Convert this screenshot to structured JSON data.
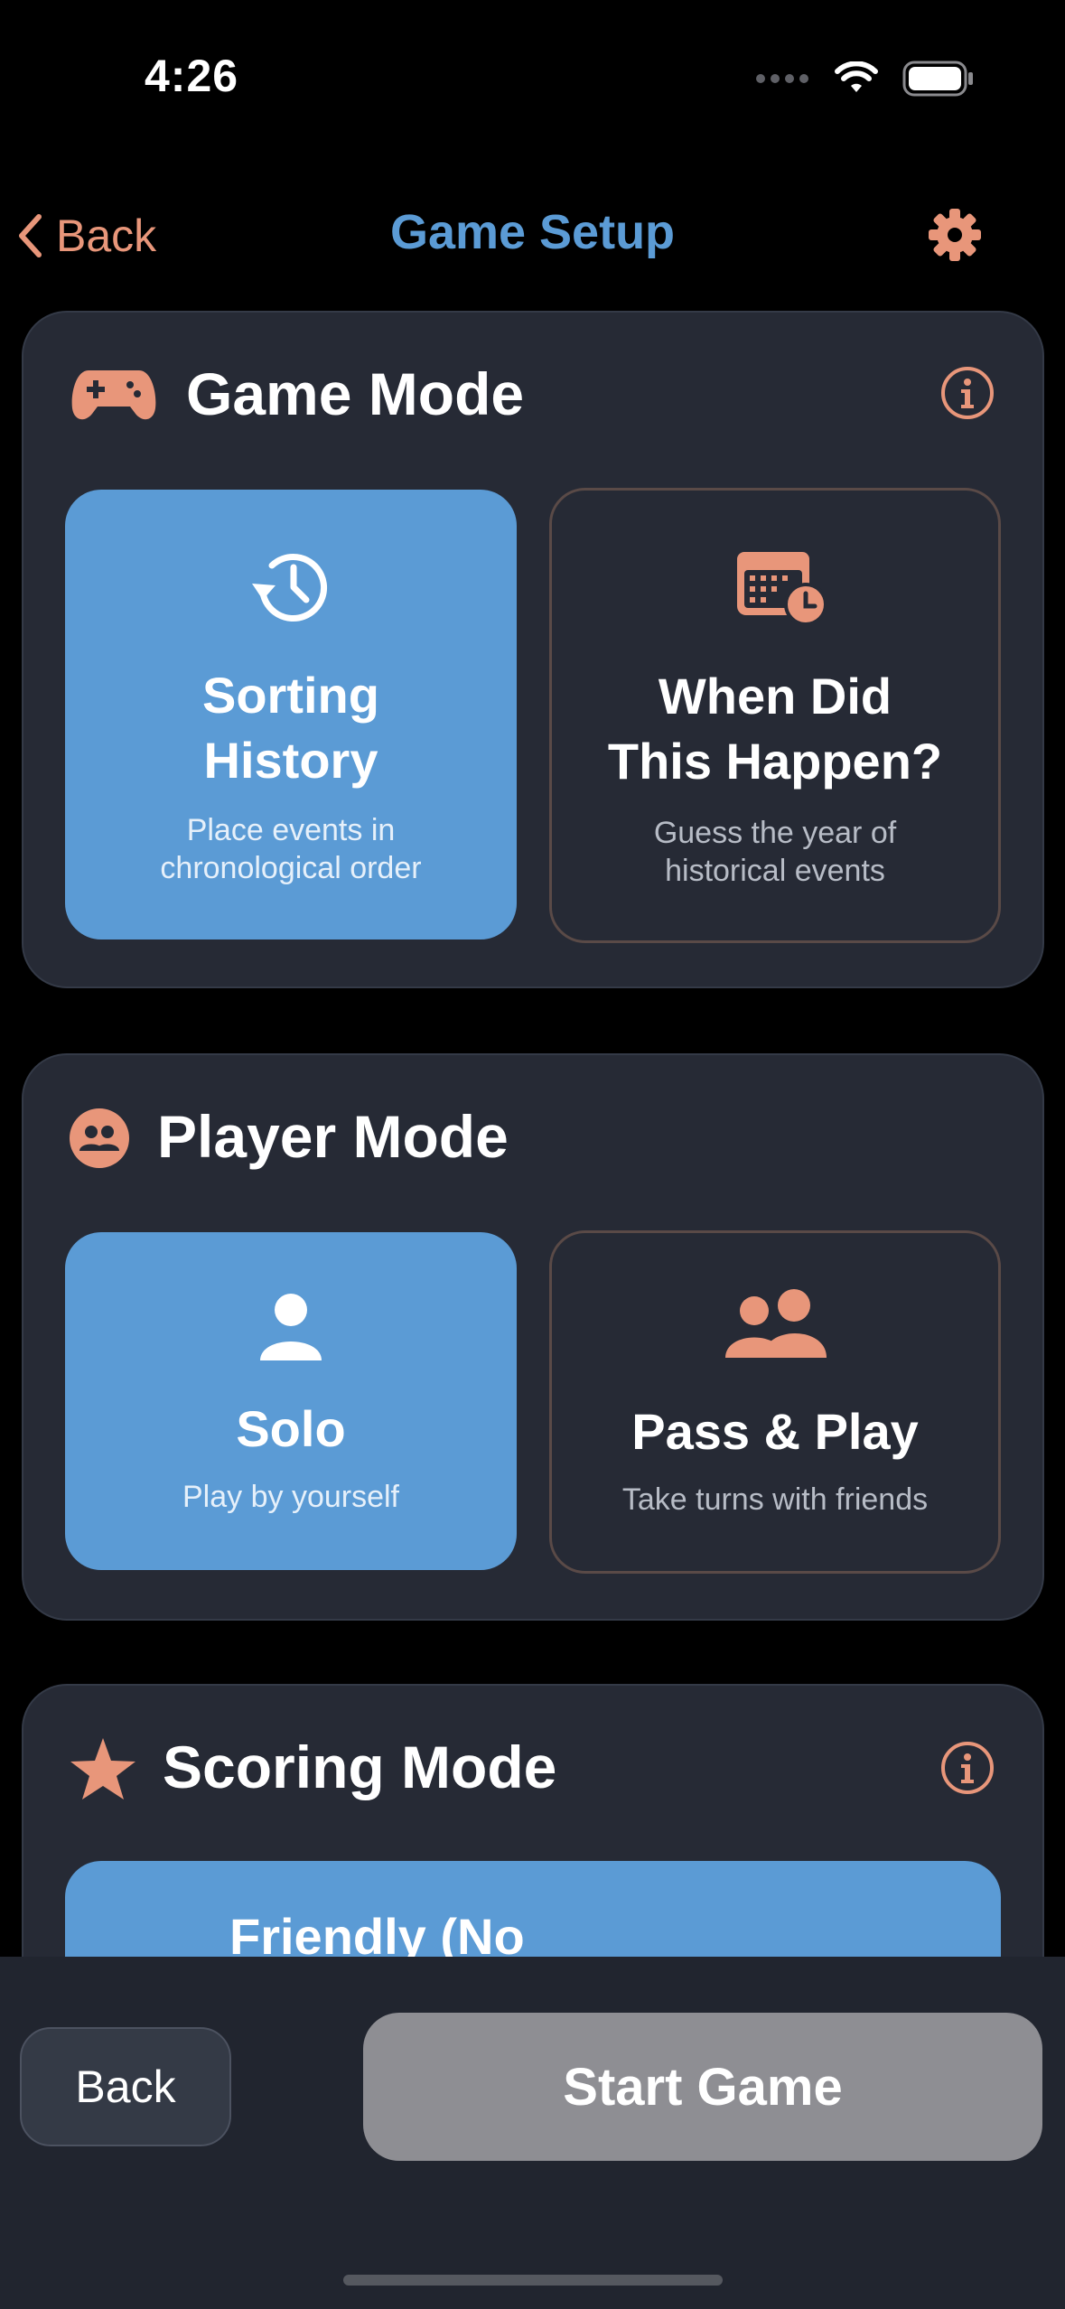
{
  "status_bar": {
    "time": "4:26"
  },
  "nav": {
    "back_label": "Back",
    "title": "Game Setup"
  },
  "game_mode": {
    "title": "Game Mode",
    "options": [
      {
        "title_line1": "Sorting",
        "title_line2": "History",
        "desc_line1": "Place events in",
        "desc_line2": "chronological order",
        "selected": true
      },
      {
        "title_line1": "When Did",
        "title_line2": "This Happen?",
        "desc_line1": "Guess the year of",
        "desc_line2": "historical events",
        "selected": false
      }
    ]
  },
  "player_mode": {
    "title": "Player Mode",
    "options": [
      {
        "title": "Solo",
        "desc": "Play by yourself",
        "selected": true
      },
      {
        "title": "Pass & Play",
        "desc": "Take turns with friends",
        "selected": false
      }
    ]
  },
  "scoring_mode": {
    "title": "Scoring Mode",
    "option_partial_label": "Friendly (No"
  },
  "bottom_bar": {
    "back_label": "Back",
    "start_label": "Start Game"
  },
  "colors": {
    "accent_orange": "#e8967a",
    "accent_blue": "#5b9bd5",
    "card_bg": "#262a35",
    "start_disabled": "#8e8e93"
  }
}
